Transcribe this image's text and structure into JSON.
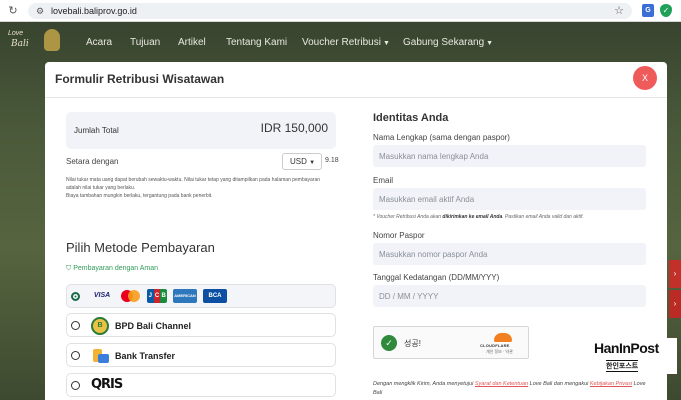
{
  "browser": {
    "url": "lovebali.baliprov.go.id"
  },
  "site": {
    "logo_top": "Love",
    "logo_main": "Bali",
    "menu": [
      "Acara",
      "Tujuan",
      "Artikel",
      "Tentang Kami",
      "Voucher Retribusi",
      "Gabung Sekarang"
    ]
  },
  "modal": {
    "title": "Formulir Retribusi Wisatawan",
    "close_label": "X",
    "total_label": "Jumlah Total",
    "total_value": "IDR 150,000",
    "equiv_label": "Setara dengan",
    "currency": "USD",
    "equiv_value": "9.18",
    "note_lines": [
      "Nilai tukar mata uang dapat berubah sewaktu-waktu. Nilai tukar tetap yang ditampilkan pada halaman pembayaran",
      "adalah nilai tukar yang berlaku.",
      "Biaya tambahan mungkin berlaku, tergantung pada bank penerbit."
    ],
    "method_title": "Pilih Metode Pembayaran",
    "secure_label": "Pembayaran dengan Aman",
    "cards": {
      "visa": "VISA",
      "jcb": [
        "J",
        "C",
        "B"
      ],
      "amex": "AMERICAN EXPRESS",
      "bca": "BCA"
    },
    "methods": [
      {
        "label": "BPD Bali Channel"
      },
      {
        "label": "Bank Transfer"
      },
      {
        "label": "QRIS"
      }
    ],
    "identity": {
      "title": "Identitas Anda",
      "name_label": "Nama Lengkap (sama dengan paspor)",
      "name_placeholder": "Masukkan nama lengkap Anda",
      "email_label": "Email",
      "email_placeholder": "Masukkan email aktif Anda",
      "email_note_pre": "* Voucher Retribusi Anda akan ",
      "email_note_bold": "dikirimkan ke email Anda",
      "email_note_post": ". Pastikan email Anda valid dan aktif.",
      "passport_label": "Nomor Paspor",
      "passport_placeholder": "Masukkan nomor paspor Anda",
      "arrival_label": "Tanggal Kedatangan (DD/MM/YYY)",
      "arrival_placeholder": "DD / MM / YYYY"
    },
    "captcha": {
      "status": "성공!",
      "brand": "CLOUDFLARE",
      "sub": "개인 정보 · 약관"
    },
    "agree": {
      "pre": "Dengan mengklik Kirim, Anda menyetujui ",
      "terms": "Syarat dan Ketentuan",
      "mid": " Love Bali dan mengakui ",
      "privacy": "Kebijakan Privasi",
      "post": " Love Bali"
    }
  },
  "watermark": {
    "main": "HanInPost",
    "sub": "한인포스트"
  },
  "colors": {
    "accent_close": "#ef5b5b",
    "secure_green": "#2f9d5a",
    "link_red": "#e05656"
  }
}
